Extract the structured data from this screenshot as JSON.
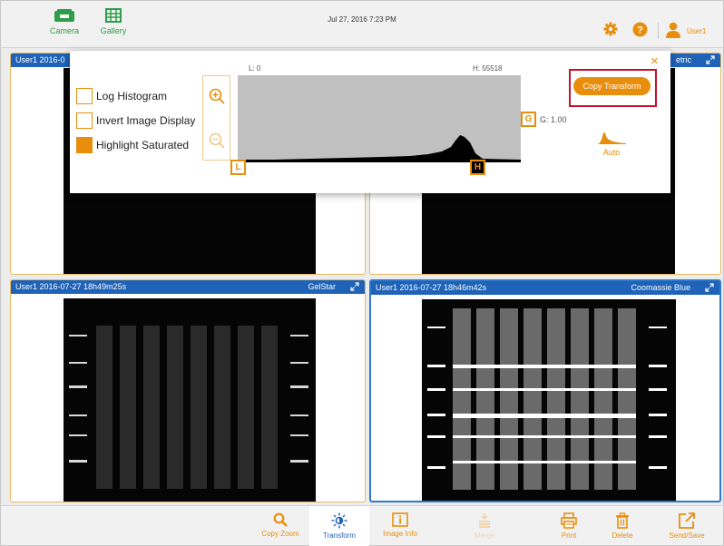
{
  "topbar": {
    "camera_label": "Camera",
    "gallery_label": "Gallery",
    "datetime": "Jul 27, 2016  7:23 PM",
    "user_label": "User1"
  },
  "panels": [
    {
      "title": "User1 2016-0",
      "stain": "",
      "active": false
    },
    {
      "title": "",
      "stain": "etric",
      "active": false
    },
    {
      "title": "User1 2016-07-27 18h49m25s",
      "stain": "GelStar",
      "active": false
    },
    {
      "title": "User1 2016-07-27 18h46m42s",
      "stain": "Coomassie Blue",
      "active": true
    }
  ],
  "transform": {
    "log_histogram_label": "Log Histogram",
    "log_histogram_checked": false,
    "invert_label": "Invert Image Display",
    "invert_checked": false,
    "highlight_label": "Highlight Saturated",
    "highlight_checked": true,
    "low_label": "L: 0",
    "high_label": "H: 55518",
    "gamma_label": "G: 1.00",
    "low_marker": "L",
    "high_marker": "H",
    "gamma_marker": "G",
    "copy_button": "Copy Transform",
    "auto_label": "Auto",
    "close_icon": "×"
  },
  "toolbar": [
    {
      "label": "Copy Zoom",
      "icon": "search-icon",
      "state": "enabled"
    },
    {
      "label": "Transform",
      "icon": "brightness-icon",
      "state": "selected"
    },
    {
      "label": "Image Info",
      "icon": "info-icon",
      "state": "enabled"
    },
    {
      "label": "Merge",
      "icon": "merge-icon",
      "state": "disabled"
    },
    {
      "label": "Print",
      "icon": "printer-icon",
      "state": "enabled"
    },
    {
      "label": "Delete",
      "icon": "trash-icon",
      "state": "enabled"
    },
    {
      "label": "Send/Save",
      "icon": "export-icon",
      "state": "enabled"
    }
  ],
  "colors": {
    "accent": "#e88e0c",
    "header_blue": "#1e63b8",
    "nav_green": "#2f9e4a",
    "highlight_red": "#c8102e"
  }
}
